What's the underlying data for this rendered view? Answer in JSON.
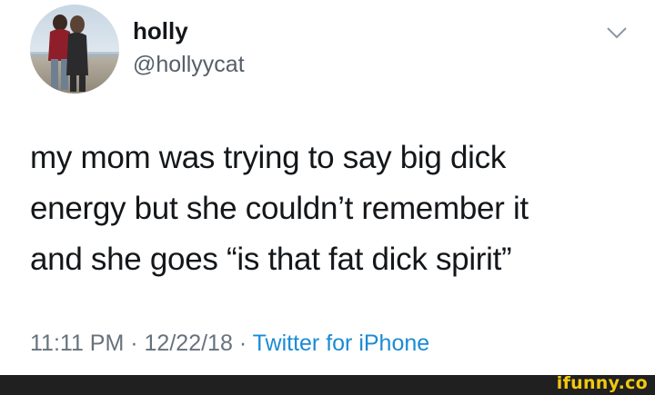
{
  "author": {
    "display_name": "holly",
    "handle": "@hollyycat",
    "avatar_icon": "profile-photo"
  },
  "menu_icon": "chevron-down-icon",
  "tweet": {
    "lines": [
      "my mom was trying to say big dick",
      "energy but she couldn’t remember it",
      "and she goes “is that fat dick spirit”"
    ],
    "time": "11:11 PM",
    "date": "12/22/18",
    "separator": "·",
    "source": "Twitter for iPhone"
  },
  "footer": {
    "watermark": "ifunny.co"
  },
  "colors": {
    "text": "#14171a",
    "secondary": "#66727c",
    "link": "#1b8bd4",
    "footer_bg": "#202020",
    "watermark": "#f2c80f"
  }
}
